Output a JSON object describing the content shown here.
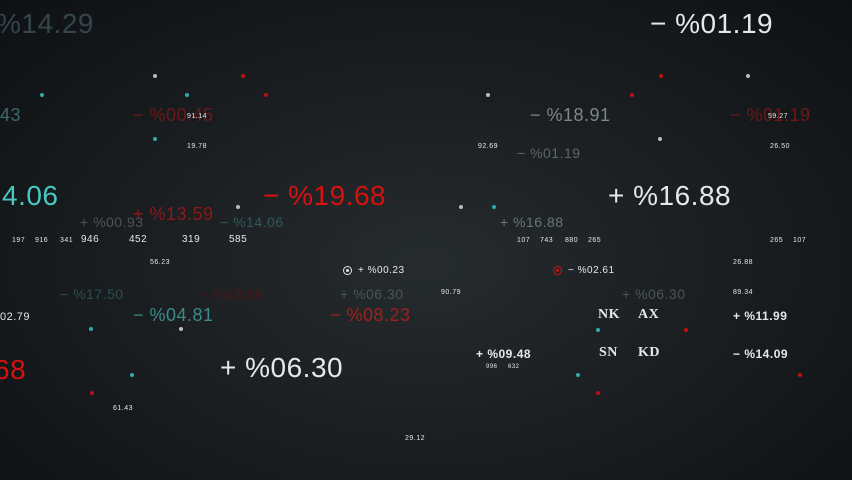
{
  "tickers": [
    {
      "text": "− %01.19"
    },
    {
      "text": "%14.29"
    },
    {
      "text": "43"
    },
    {
      "text": "− %00.45"
    },
    {
      "text": "91.14"
    },
    {
      "text": "− %18.91"
    },
    {
      "text": "− %01.19"
    },
    {
      "text": "59.27"
    },
    {
      "text": "19.78"
    },
    {
      "text": "92.69"
    },
    {
      "text": "− %01.19"
    },
    {
      "text": "26.50"
    },
    {
      "text": "4.06"
    },
    {
      "text": "− %19.68"
    },
    {
      "text": "+ %16.88"
    },
    {
      "text": "+ %00.93"
    },
    {
      "text": "+ %13.59"
    },
    {
      "text": "− %14.06"
    },
    {
      "text": "+ %16.88"
    },
    {
      "text": "946"
    },
    {
      "text": "452"
    },
    {
      "text": "319"
    },
    {
      "text": "585"
    },
    {
      "text": "197"
    },
    {
      "text": "916"
    },
    {
      "text": "341"
    },
    {
      "text": "107"
    },
    {
      "text": "743"
    },
    {
      "text": "880"
    },
    {
      "text": "265"
    },
    {
      "text": "265"
    },
    {
      "text": "107"
    },
    {
      "text": "56.23"
    },
    {
      "text": "+ %00.23"
    },
    {
      "text": "− %02.61"
    },
    {
      "text": "26.88"
    },
    {
      "text": "90.79"
    },
    {
      "text": "89.34"
    },
    {
      "text": "− %17.50"
    },
    {
      "text": "− %13.68"
    },
    {
      "text": "+ %06.30"
    },
    {
      "text": "+ %06.30"
    },
    {
      "text": "02.79"
    },
    {
      "text": "− %04.81"
    },
    {
      "text": "− %08.23"
    },
    {
      "text": "NK"
    },
    {
      "text": "AX"
    },
    {
      "text": "+ %11.99"
    },
    {
      "text": "68"
    },
    {
      "text": "+ %06.30"
    },
    {
      "text": "+ %09.48"
    },
    {
      "text": "SN"
    },
    {
      "text": "KD"
    },
    {
      "text": "− %14.09"
    },
    {
      "text": "996"
    },
    {
      "text": "632"
    },
    {
      "text": "61.43"
    },
    {
      "text": "29.12"
    }
  ],
  "colors": {
    "teal": "#47c8c0",
    "red": "#d8100e",
    "white": "#e4e8ea",
    "background": "#1b1f22"
  }
}
